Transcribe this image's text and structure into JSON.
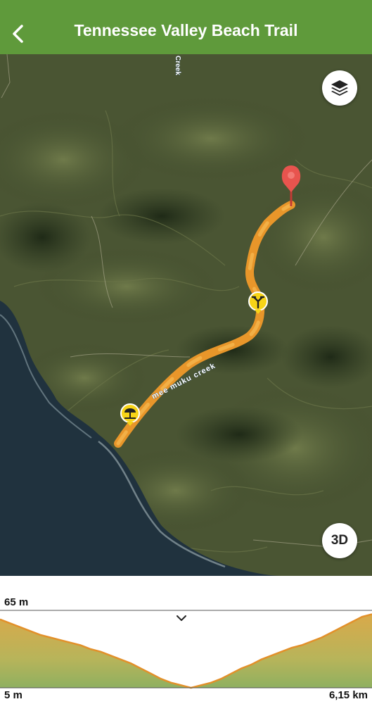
{
  "header": {
    "title": "Tennessee Valley Beach Trail",
    "back_icon": "chevron-left-icon",
    "background_color": "#5f9a3b"
  },
  "map": {
    "view": "satellite",
    "labels": {
      "creek_main": "mee muku creek",
      "creek_top": "Creek"
    },
    "route_color": "#f0a02c",
    "markers": [
      {
        "name": "trailhead-pin",
        "icon": "map-pin-icon",
        "color": "#e8544e"
      },
      {
        "name": "junction-marker",
        "icon": "trail-junction-icon",
        "color": "#f7d417"
      },
      {
        "name": "beach-marker",
        "icon": "beach-umbrella-icon",
        "color": "#f7d417"
      }
    ],
    "layers_button_icon": "layers-icon",
    "three_d_label": "3D"
  },
  "elevation": {
    "collapse_icon": "chevron-down-icon",
    "max_label": "65 m",
    "min_label": "5 m",
    "distance_label": "6,15 km",
    "profile": [
      58,
      55,
      52,
      49,
      46,
      44,
      42,
      40,
      38,
      35,
      33,
      30,
      27,
      24,
      20,
      16,
      12,
      9,
      7,
      5,
      7,
      9,
      12,
      16,
      20,
      23,
      27,
      30,
      33,
      36,
      38,
      41,
      44,
      48,
      52,
      56,
      60,
      62
    ]
  }
}
